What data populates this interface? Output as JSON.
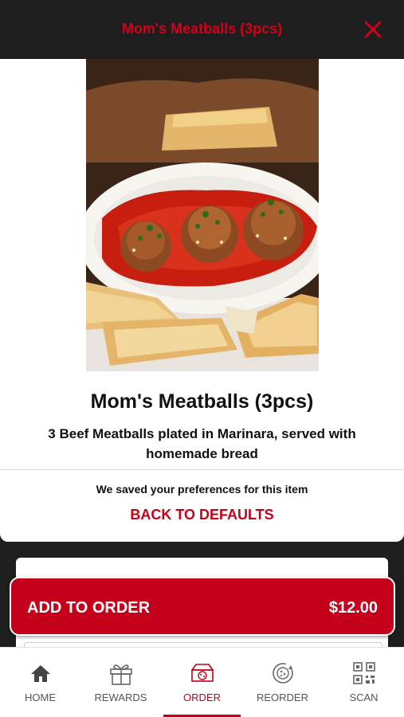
{
  "header": {
    "title": "Mom's Meatballs (3pcs)",
    "close_icon": "close-icon"
  },
  "item": {
    "name": "Mom's Meatballs (3pcs)",
    "description": "3 Beef Meatballs plated in Marinara, served with homemade bread",
    "image_icon": "meatballs-photo"
  },
  "preferences": {
    "message": "We saved your preferences for this item",
    "reset_label": "BACK TO DEFAULTS"
  },
  "order_button": {
    "label": "ADD TO ORDER",
    "price": "$12.00"
  },
  "nav": {
    "items": [
      {
        "label": "HOME",
        "icon": "home-icon"
      },
      {
        "label": "REWARDS",
        "icon": "gift-icon"
      },
      {
        "label": "ORDER",
        "icon": "pizza-box-icon",
        "active": true
      },
      {
        "label": "REORDER",
        "icon": "reorder-icon"
      },
      {
        "label": "SCAN",
        "icon": "qr-code-icon"
      }
    ]
  },
  "colors": {
    "accent": "#c4001a",
    "header_bg": "#1e1e1e"
  }
}
